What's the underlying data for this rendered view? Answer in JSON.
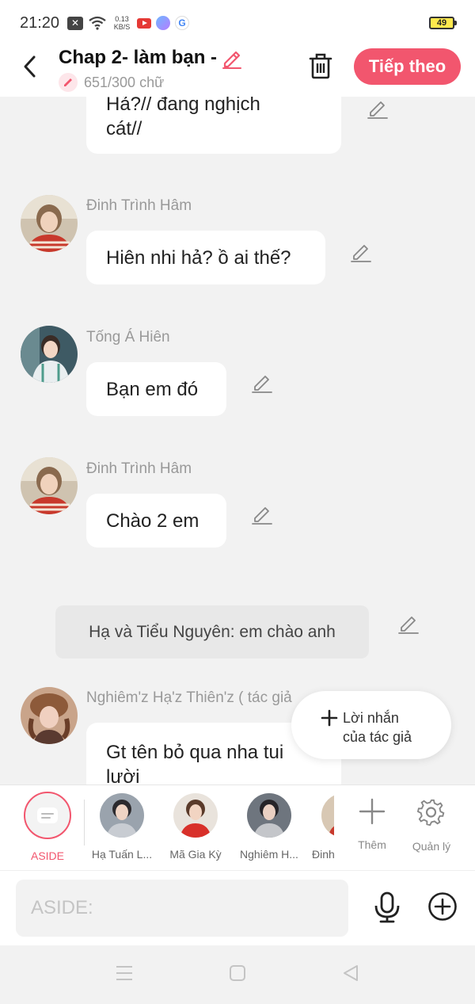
{
  "status_bar": {
    "time": "21:20",
    "speed_value": "0.13",
    "speed_unit": "KB/S",
    "battery": "49",
    "google": "G"
  },
  "header": {
    "title": "Chap 2- làm bạn -",
    "word_count": "651/300 chữ",
    "next_label": "Tiếp theo"
  },
  "messages": [
    {
      "type": "bubble",
      "text_line1": "Hả?// đang nghịch",
      "text_line2": "cát//"
    },
    {
      "type": "dialog",
      "name": "Đinh Trình Hâm",
      "text": "Hiên nhi hả? ồ ai thế?"
    },
    {
      "type": "dialog",
      "name": "Tống Á Hiên",
      "text": "Bạn em đó"
    },
    {
      "type": "dialog",
      "name": "Đinh Trình Hâm",
      "text": "Chào 2 em"
    },
    {
      "type": "aside",
      "text": "Hạ và Tiểu Nguyên: em chào anh"
    },
    {
      "type": "dialog",
      "name": "Nghiêm'z Hạ'z Thiên'z ( tác giả",
      "text_line1": "Gt tên bỏ qua nha tui",
      "text_line2": "lười"
    }
  ],
  "author_note": {
    "line1": "Lời nhắn",
    "line2": "của tác giả"
  },
  "characters": [
    {
      "label": "ASIDE",
      "active": true
    },
    {
      "label": "Hạ Tuấn L..."
    },
    {
      "label": "Mã Gia Kỳ"
    },
    {
      "label": "Nghiêm H..."
    },
    {
      "label": "Đinh"
    }
  ],
  "tools": {
    "add_label": "Thêm",
    "manage_label": "Quản lý"
  },
  "input": {
    "placeholder": "ASIDE:"
  },
  "colors": {
    "accent": "#f2566e",
    "background": "#f2f2f2"
  }
}
